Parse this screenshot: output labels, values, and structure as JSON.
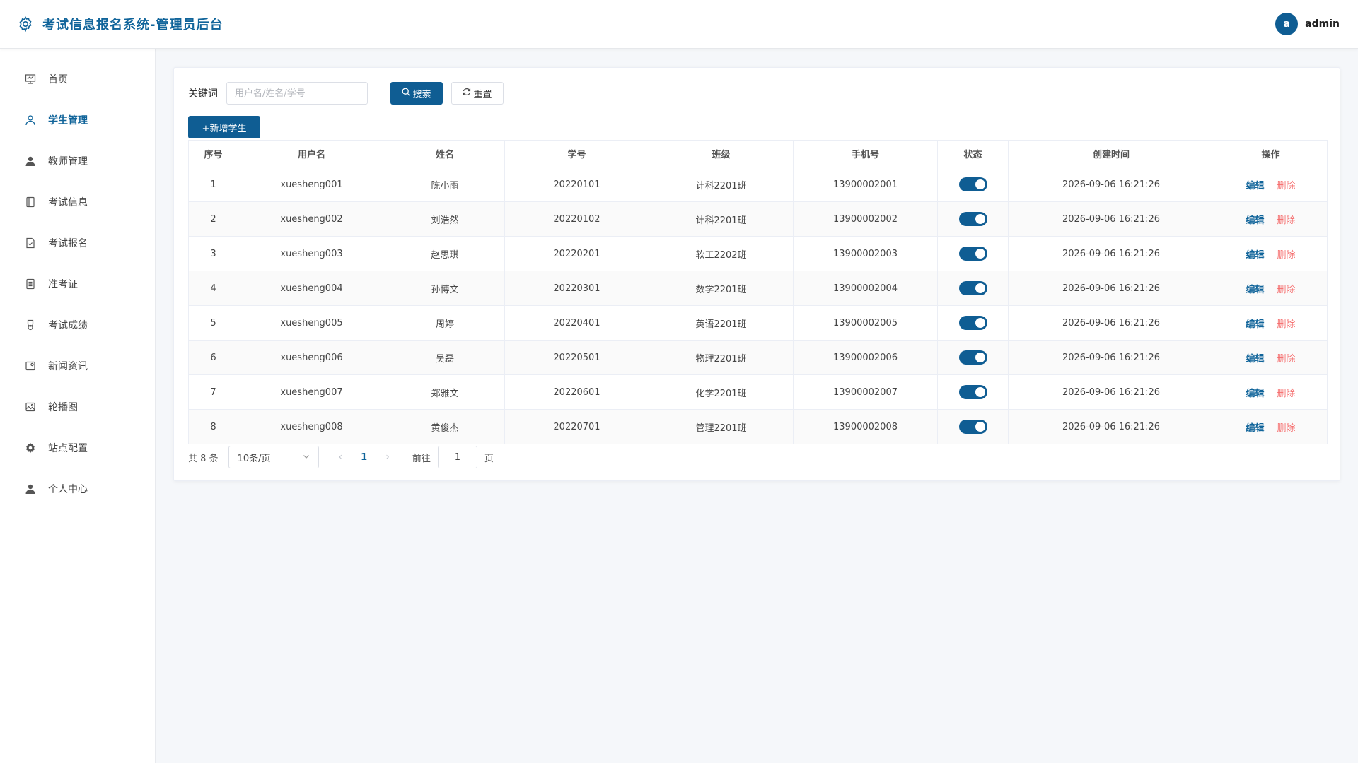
{
  "header": {
    "title": "考试信息报名系统-管理员后台",
    "avatar_letter": "a",
    "username": "admin"
  },
  "sidebar": {
    "items": [
      {
        "label": "首页",
        "icon": "presentation-icon"
      },
      {
        "label": "学生管理",
        "icon": "user-outline-icon"
      },
      {
        "label": "教师管理",
        "icon": "user-filled-icon"
      },
      {
        "label": "考试信息",
        "icon": "notebook-icon"
      },
      {
        "label": "考试报名",
        "icon": "document-checked-icon"
      },
      {
        "label": "准考证",
        "icon": "tickets-icon"
      },
      {
        "label": "考试成绩",
        "icon": "medal-icon"
      },
      {
        "label": "新闻资讯",
        "icon": "postcard-icon"
      },
      {
        "label": "轮播图",
        "icon": "picture-icon"
      },
      {
        "label": "站点配置",
        "icon": "gear-icon"
      },
      {
        "label": "个人中心",
        "icon": "avatar-icon"
      }
    ],
    "active_index": 1
  },
  "search": {
    "label": "关键词",
    "placeholder": "用户名/姓名/学号",
    "value": "",
    "search_label": "搜索",
    "reset_label": "重置"
  },
  "toolbar": {
    "add_label": "+新增学生"
  },
  "table": {
    "columns": [
      "序号",
      "用户名",
      "姓名",
      "学号",
      "班级",
      "手机号",
      "状态",
      "创建时间",
      "操作"
    ],
    "edit_label": "编辑",
    "delete_label": "删除",
    "rows": [
      {
        "index": "1",
        "username": "xuesheng001",
        "name": "陈小雨",
        "student_no": "20220101",
        "class": "计科2201班",
        "phone": "13900002001",
        "enabled": true,
        "created": "2026-09-06 16:21:26"
      },
      {
        "index": "2",
        "username": "xuesheng002",
        "name": "刘浩然",
        "student_no": "20220102",
        "class": "计科2201班",
        "phone": "13900002002",
        "enabled": true,
        "created": "2026-09-06 16:21:26"
      },
      {
        "index": "3",
        "username": "xuesheng003",
        "name": "赵思琪",
        "student_no": "20220201",
        "class": "软工2202班",
        "phone": "13900002003",
        "enabled": true,
        "created": "2026-09-06 16:21:26"
      },
      {
        "index": "4",
        "username": "xuesheng004",
        "name": "孙博文",
        "student_no": "20220301",
        "class": "数学2201班",
        "phone": "13900002004",
        "enabled": true,
        "created": "2026-09-06 16:21:26"
      },
      {
        "index": "5",
        "username": "xuesheng005",
        "name": "周婷",
        "student_no": "20220401",
        "class": "英语2201班",
        "phone": "13900002005",
        "enabled": true,
        "created": "2026-09-06 16:21:26"
      },
      {
        "index": "6",
        "username": "xuesheng006",
        "name": "吴磊",
        "student_no": "20220501",
        "class": "物理2201班",
        "phone": "13900002006",
        "enabled": true,
        "created": "2026-09-06 16:21:26"
      },
      {
        "index": "7",
        "username": "xuesheng007",
        "name": "郑雅文",
        "student_no": "20220601",
        "class": "化学2201班",
        "phone": "13900002007",
        "enabled": true,
        "created": "2026-09-06 16:21:26"
      },
      {
        "index": "8",
        "username": "xuesheng008",
        "name": "黄俊杰",
        "student_no": "20220701",
        "class": "管理2201班",
        "phone": "13900002008",
        "enabled": true,
        "created": "2026-09-06 16:21:26"
      }
    ]
  },
  "pagination": {
    "total_text": "共 8 条",
    "page_size": "10条/页",
    "current_page": "1",
    "goto_label": "前往",
    "goto_value": "1",
    "page_suffix": "页"
  },
  "colors": {
    "primary": "#0f5d93",
    "danger": "#f56c6c",
    "background": "#f5f7fa"
  }
}
